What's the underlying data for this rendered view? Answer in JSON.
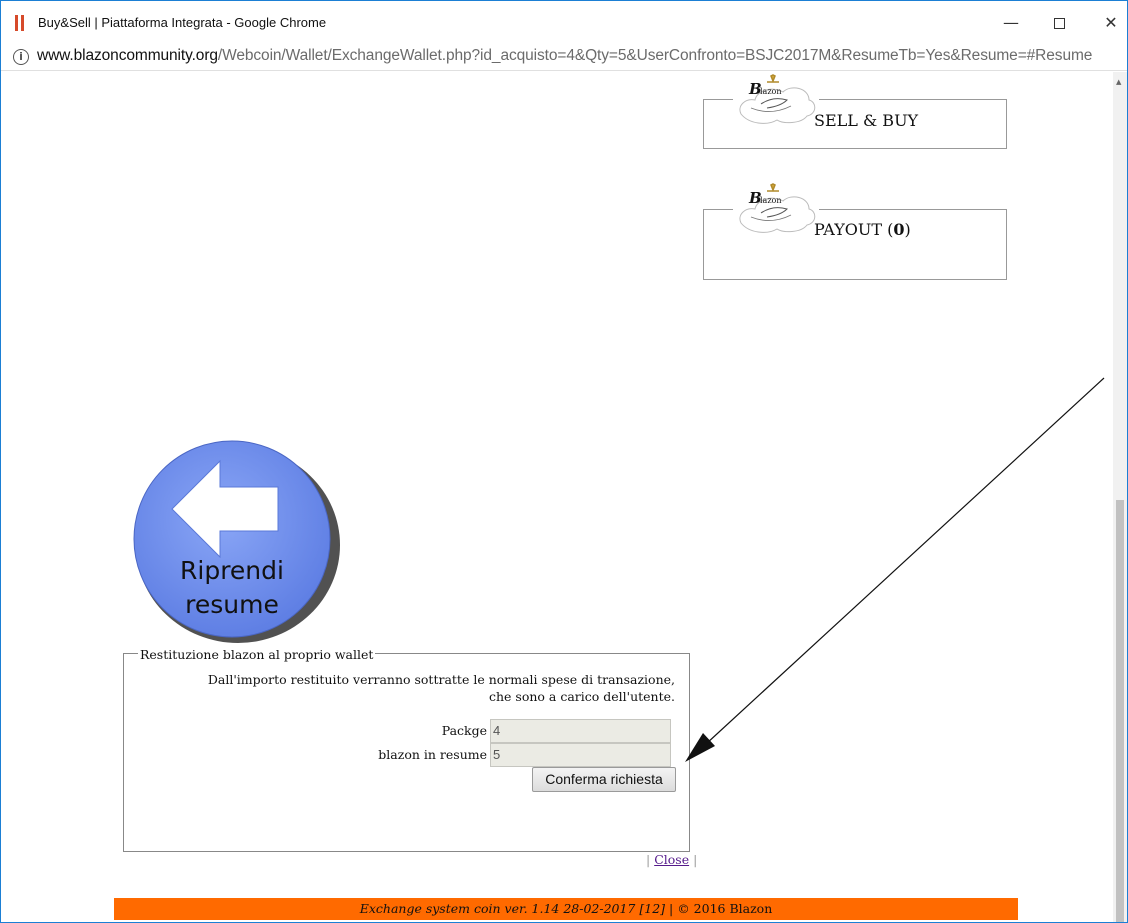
{
  "window": {
    "title": "Buy&Sell | Piattaforma Integrata - Google Chrome",
    "controls": {
      "minimize": "—",
      "maximize": "",
      "close": "✕"
    }
  },
  "address_bar": {
    "host": "www.blazoncommunity.org",
    "path": "/Webcoin/Wallet/ExchangeWallet.php?id_acquisto=4&Qty=5&UserConfronto=BSJC2017M&ResumeTb=Yes&Resume=#Resume",
    "info_icon": "info-icon"
  },
  "menu": {
    "items": [
      {
        "label": "SELL & BUY",
        "logo_icon": "blazon-logo-icon"
      },
      {
        "label_prefix": "PAYOUT (",
        "count": "0",
        "label_suffix": ")",
        "logo_icon": "blazon-logo-icon"
      }
    ],
    "logo_text": "Blazon"
  },
  "resume_button": {
    "line1": "Riprendi",
    "line2": "resume",
    "icon": "back-arrow-icon",
    "colors": {
      "fill": "#6f8ff0",
      "arrow": "#ffffff"
    }
  },
  "form": {
    "legend": "Restituzione blazon al proprio wallet",
    "notice_line1": "Dall'importo restituito verranno sottratte le normali spese di transazione,",
    "notice_line2": "che sono a carico dell'utente.",
    "fields": [
      {
        "label": "Packge",
        "value": "4"
      },
      {
        "label": "blazon in resume",
        "value": "5"
      }
    ],
    "submit_label": "Conferma richiesta"
  },
  "close_link": {
    "prefix": "| ",
    "label": "Close",
    "suffix": " |"
  },
  "footer": {
    "version_text": "Exchange system coin ver. 1.14 28-02-2017 [12]",
    "separator": " | ",
    "copyright": "© 2016 Blazon",
    "color": "#ff6a00"
  }
}
